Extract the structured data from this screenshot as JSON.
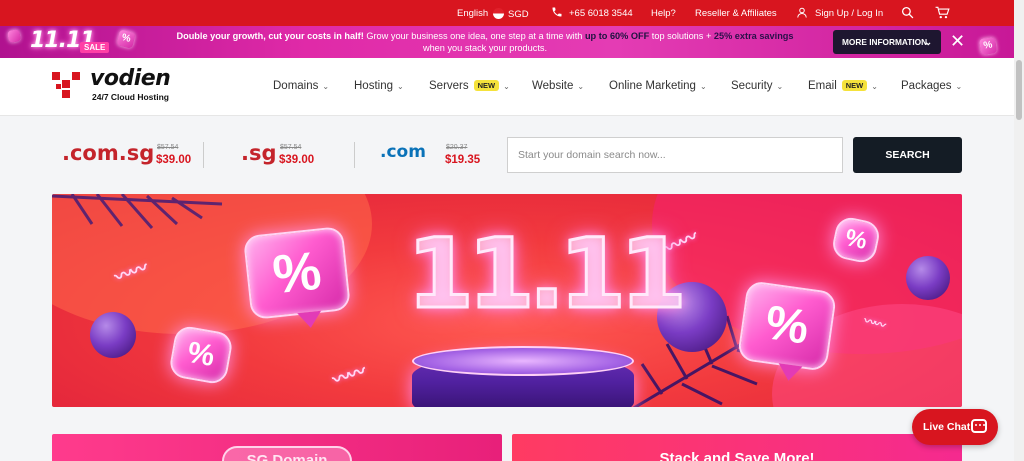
{
  "topbar": {
    "language": "English",
    "currency": "SGD",
    "phone": "+65 6018 3544",
    "help": "Help?",
    "reseller": "Reseller & Affiliates",
    "signup": "Sign Up / Log In",
    "icons": [
      "phone-icon",
      "user-icon",
      "search-icon",
      "cart-icon"
    ]
  },
  "promo": {
    "logo_text": "11.11",
    "sale_label": "SALE",
    "bubble_symbol": "%",
    "text_bold": "Double your growth, cut your costs in half!",
    "text_mid": " Grow your business one idea, one step at a time with ",
    "highlight1": "up to 60% OFF",
    "text_mid2": " top solutions + ",
    "highlight2": "25% extra savings",
    "text_end": " when you stack your products.",
    "more_button": "MORE INFORMATION",
    "close_symbol": "✕"
  },
  "header": {
    "brand": "vodien",
    "tagline": "24/7 Cloud Hosting",
    "nav": [
      {
        "label": "Domains",
        "badge": ""
      },
      {
        "label": "Hosting",
        "badge": ""
      },
      {
        "label": "Servers",
        "badge": "NEW"
      },
      {
        "label": "Website",
        "badge": ""
      },
      {
        "label": "Online Marketing",
        "badge": ""
      },
      {
        "label": "Security",
        "badge": ""
      },
      {
        "label": "Email",
        "badge": "NEW"
      },
      {
        "label": "Packages",
        "badge": ""
      }
    ]
  },
  "domains": [
    {
      "ext": ".com.sg",
      "old_price": "$57.54",
      "price": "$39.00"
    },
    {
      "ext": ".sg",
      "old_price": "$57.54",
      "price": "$39.00"
    },
    {
      "ext": ".com",
      "old_price": "$20.37",
      "price": "$19.35"
    }
  ],
  "search": {
    "placeholder": "Start your domain search now...",
    "button": "SEARCH"
  },
  "hero": {
    "headline": "11.11",
    "symbol": "%"
  },
  "cards": [
    {
      "title": "SG Domain"
    },
    {
      "title": "Stack and Save More!"
    }
  ],
  "livechat": {
    "label": "Live Chat"
  },
  "colors": {
    "brand_red": "#d8151f",
    "promo_pink": "#e02aa8",
    "dark_button": "#141c25",
    "badge_yellow": "#f5e23b"
  }
}
